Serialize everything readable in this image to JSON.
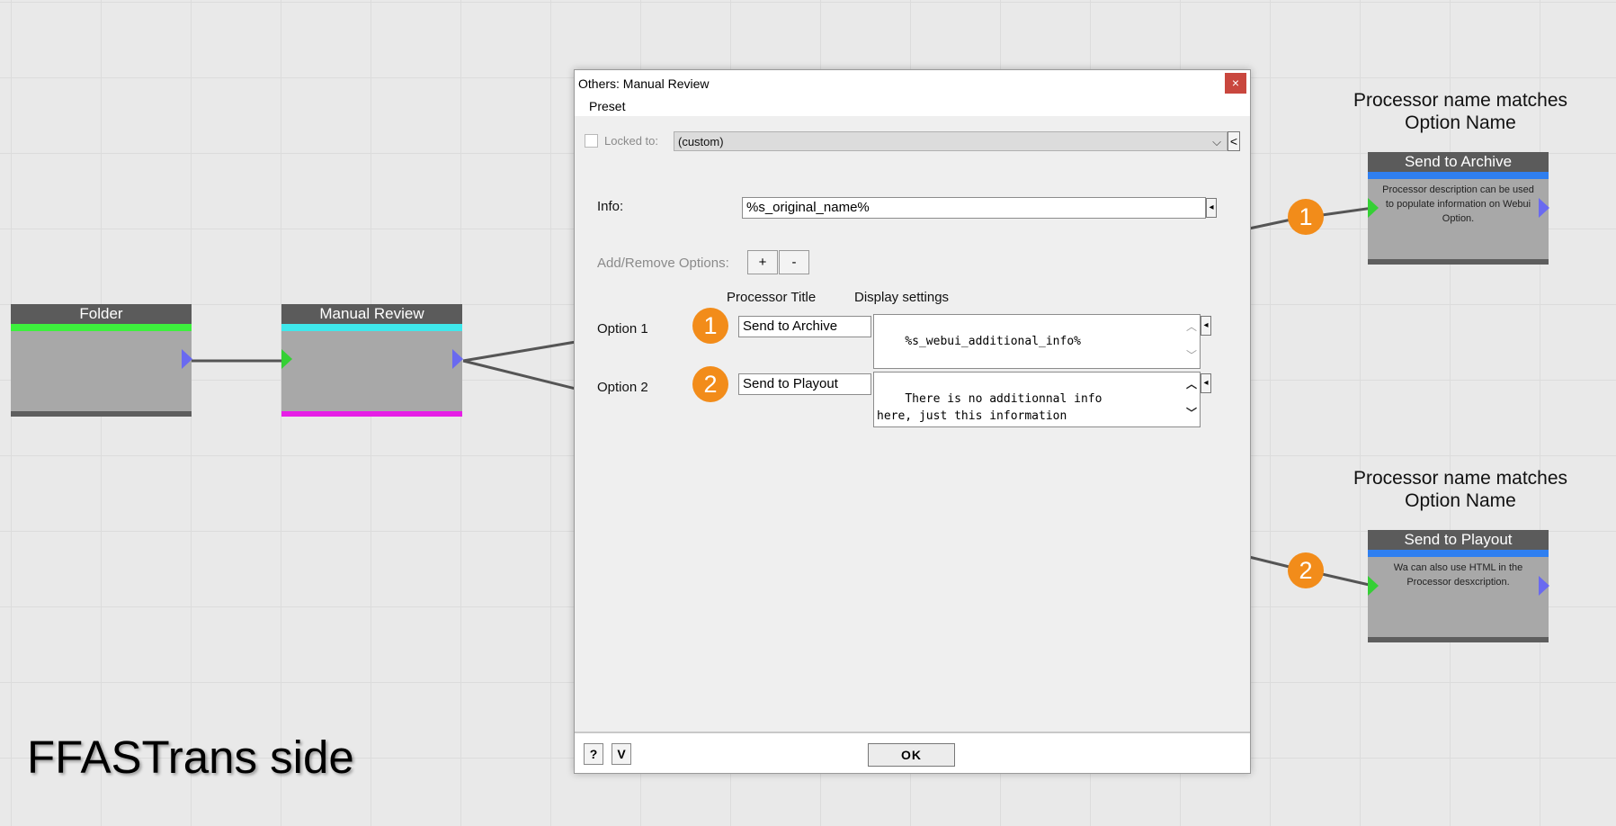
{
  "canvas": {
    "side_label": "FFASTrans side",
    "caption_top": [
      "Processor name matches",
      "Option Name"
    ],
    "caption_bottom": [
      "Processor name matches",
      "Option Name"
    ],
    "badges": [
      "1",
      "2"
    ]
  },
  "nodes": {
    "folder": {
      "title": "Folder",
      "bar_color": "#3df03d"
    },
    "manual_review": {
      "title": "Manual Review",
      "bar_color": "#3fe8ec",
      "foot_color": "#e61ee6"
    },
    "send_to_archive": {
      "title": "Send to Archive",
      "bar_color": "#2f7ff0",
      "description": "Processor description can be used to populate information on Webui Option."
    },
    "send_to_playout": {
      "title": "Send to Playout",
      "bar_color": "#2f7ff0",
      "description": "Wa can also use HTML in the Processor desxcription."
    }
  },
  "dialog": {
    "title": "Others: Manual Review",
    "close_glyph": "×",
    "menu": {
      "preset": "Preset"
    },
    "locked_to_label": "Locked to:",
    "locked_to_value": "(custom)",
    "combo_arrow": "⌵",
    "side_button": "<",
    "info_label": "Info:",
    "info_value": "%s_original_name%",
    "add_remove_label": "Add/Remove Options:",
    "add_button": "+",
    "remove_button": "-",
    "col_processor_title": "Processor Title",
    "col_display_settings": "Display settings",
    "options": [
      {
        "label": "Option 1",
        "badge": "1",
        "title": "Send to Archive",
        "display": "%s_webui_additional_info%"
      },
      {
        "label": "Option 2",
        "badge": "2",
        "title": "Send to Playout",
        "display": "There is no additionnal info\nhere, just this information\ntext. We can use Variable like %"
      }
    ],
    "help_button": "?",
    "v_button": "V",
    "ok_button": "OK"
  }
}
